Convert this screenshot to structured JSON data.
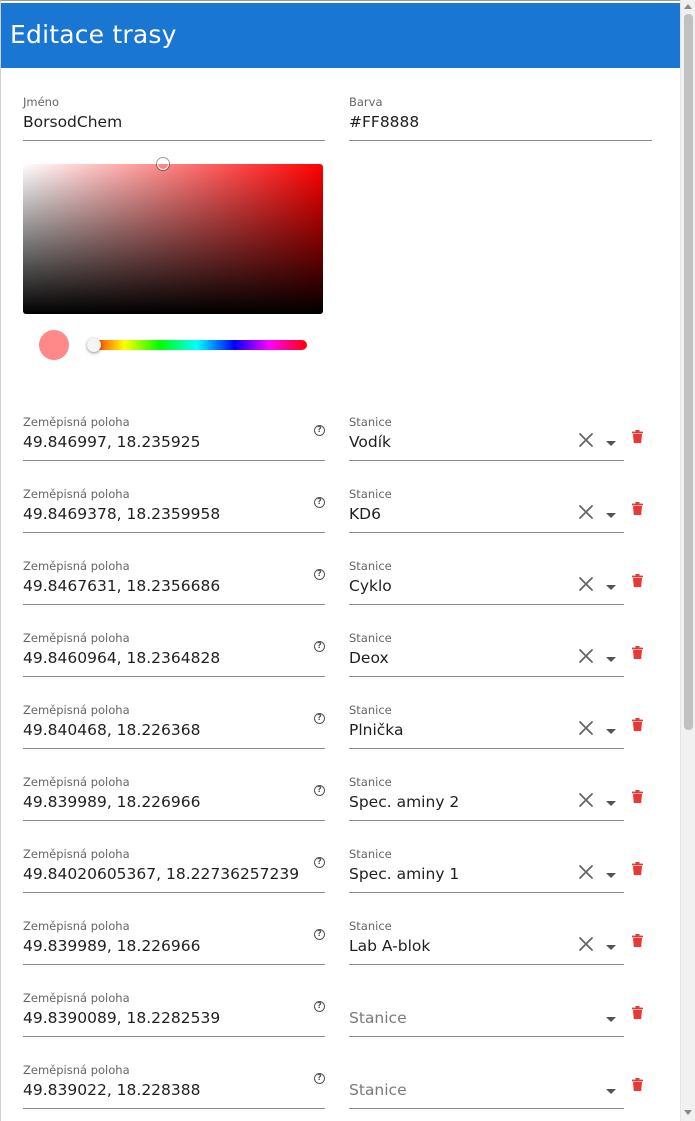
{
  "header": {
    "title": "Editace trasy"
  },
  "form": {
    "name_label": "Jméno",
    "name_value": "BorsodChem",
    "color_label": "Barva",
    "color_value": "#FF8888"
  },
  "colors": {
    "header_bg": "#1976d2",
    "swatch": "#FF8888",
    "delete": "#e53935"
  },
  "stops": [
    {
      "location_label": "Zeměpisná poloha",
      "location": "49.846997, 18.235925",
      "station_label": "Stanice",
      "station": "Vodík"
    },
    {
      "location_label": "Zeměpisná poloha",
      "location": "49.8469378, 18.2359958",
      "station_label": "Stanice",
      "station": "KD6"
    },
    {
      "location_label": "Zeměpisná poloha",
      "location": "49.8467631, 18.2356686",
      "station_label": "Stanice",
      "station": "Cyklo"
    },
    {
      "location_label": "Zeměpisná poloha",
      "location": "49.8460964, 18.2364828",
      "station_label": "Stanice",
      "station": "Deox"
    },
    {
      "location_label": "Zeměpisná poloha",
      "location": "49.840468, 18.226368",
      "station_label": "Stanice",
      "station": "Plnička"
    },
    {
      "location_label": "Zeměpisná poloha",
      "location": "49.839989, 18.226966",
      "station_label": "Stanice",
      "station": "Spec. aminy 2"
    },
    {
      "location_label": "Zeměpisná poloha",
      "location": "49.84020605367, 18.22736257239",
      "station_label": "Stanice",
      "station": "Spec. aminy 1"
    },
    {
      "location_label": "Zeměpisná poloha",
      "location": "49.839989, 18.226966",
      "station_label": "Stanice",
      "station": "Lab A-blok"
    },
    {
      "location_label": "Zeměpisná poloha",
      "location": "49.8390089, 18.2282539",
      "station_placeholder": "Stanice"
    },
    {
      "location_label": "Zeměpisná poloha",
      "location": "49.839022, 18.228388",
      "station_placeholder": "Stanice"
    }
  ]
}
